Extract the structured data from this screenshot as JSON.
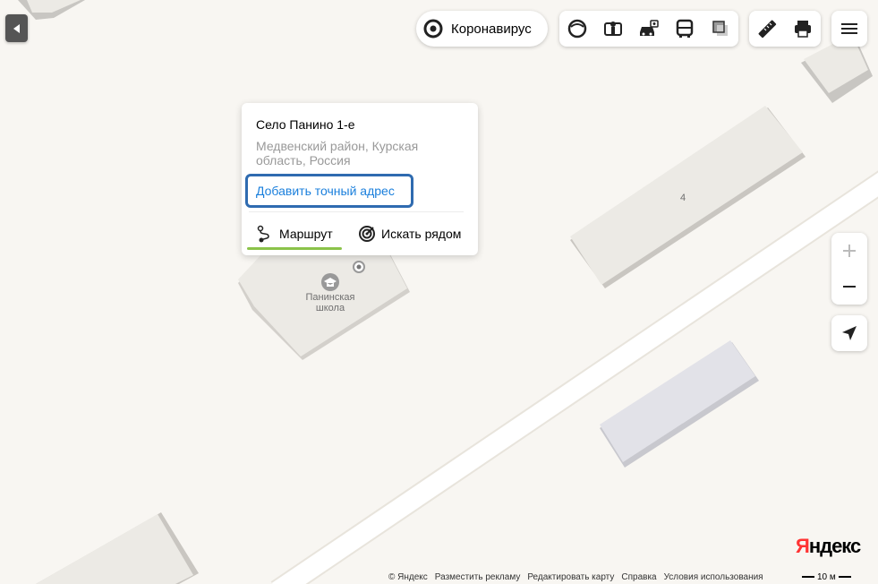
{
  "map": {
    "building_number": "4",
    "school_label_line1": "Панинская",
    "school_label_line2": "школа"
  },
  "toolbar": {
    "coronavirus_label": "Коронавирус",
    "layers": [
      "satellite-layer-icon",
      "panorama-layer-icon",
      "traffic-layer-icon",
      "transport-layer-icon",
      "map-layer-icon"
    ],
    "tools": [
      "ruler-icon",
      "print-icon"
    ]
  },
  "place_card": {
    "title": "Село Панино 1-е",
    "address": "Медвенский район, Курская область, Россия",
    "add_address_link": "Добавить точный адрес",
    "route_label": "Маршрут",
    "nearby_label": "Искать рядом",
    "route_underline_color": "#8bc34a",
    "link_color": "#1a7fdc"
  },
  "footer": {
    "copyright": "© Яндекс",
    "advertise": "Разместить рекламу",
    "edit_map": "Редактировать карту",
    "help": "Справка",
    "terms": "Условия использования",
    "scale": "10 м"
  },
  "logo": {
    "first_letter": "Я",
    "rest": "ндекс"
  }
}
